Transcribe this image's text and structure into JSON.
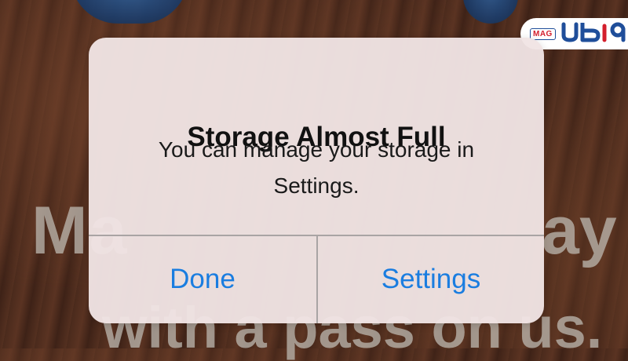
{
  "alert": {
    "title": "Storage Almost Full",
    "message": "You can manage your storage in Settings.",
    "buttons": {
      "done_label": "Done",
      "settings_label": "Settings"
    },
    "button_color": "#1a7de0"
  },
  "background": {
    "text_line1_left": "Ma",
    "text_line1_right": "ay",
    "text_line2": "with a pass on us."
  },
  "watermark": {
    "mag_label": "MAG",
    "brand": "UBIQ"
  }
}
